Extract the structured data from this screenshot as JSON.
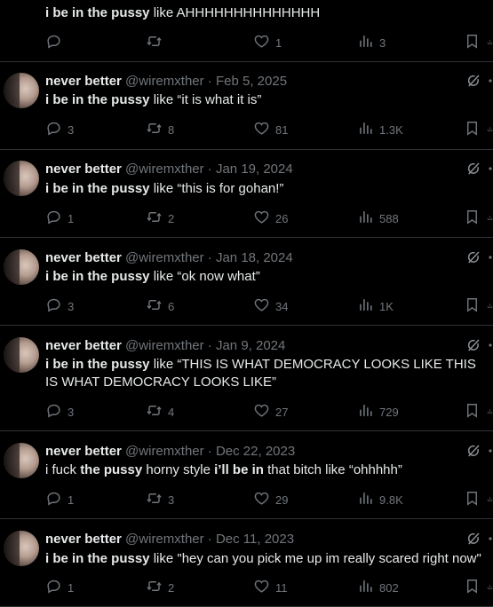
{
  "icons": {
    "reply": "speech-bubble-icon",
    "retweet": "retweet-arrows-icon",
    "like": "heart-icon",
    "views": "bar-chart-icon",
    "bookmark": "bookmark-icon",
    "grok": "grok-slash-circle-icon",
    "share": "share-icon"
  },
  "colors": {
    "background": "#000000",
    "text": "#e7e9ea",
    "muted": "#71767b",
    "divider": "#2f3336"
  },
  "tweets": [
    {
      "name": "",
      "handle": "",
      "date": "",
      "text_parts": [
        {
          "b": "i be in the pussy"
        },
        {
          "t": " like AHHHHHHHHHHHHHH"
        }
      ],
      "replies": "",
      "retweets": "",
      "likes": "1",
      "views": "3"
    },
    {
      "name": "never better",
      "handle": "@wiremxther",
      "date": "Feb 5, 2025",
      "text_parts": [
        {
          "b": "i be in the pussy"
        },
        {
          "t": " like “it is what it is”"
        }
      ],
      "replies": "3",
      "retweets": "8",
      "likes": "81",
      "views": "1.3K"
    },
    {
      "name": "never better",
      "handle": "@wiremxther",
      "date": "Jan 19, 2024",
      "text_parts": [
        {
          "b": "i be in the pussy"
        },
        {
          "t": " like “this is for gohan!”"
        }
      ],
      "replies": "1",
      "retweets": "2",
      "likes": "26",
      "views": "588"
    },
    {
      "name": "never better",
      "handle": "@wiremxther",
      "date": "Jan 18, 2024",
      "text_parts": [
        {
          "b": "i be in the pussy"
        },
        {
          "t": " like “ok now what”"
        }
      ],
      "replies": "3",
      "retweets": "6",
      "likes": "34",
      "views": "1K"
    },
    {
      "name": "never better",
      "handle": "@wiremxther",
      "date": "Jan 9, 2024",
      "text_parts": [
        {
          "b": "i be in the pussy"
        },
        {
          "t": " like “THIS IS WHAT DEMOCRACY LOOKS LIKE THIS IS WHAT DEMOCRACY LOOKS LIKE”"
        }
      ],
      "replies": "3",
      "retweets": "4",
      "likes": "27",
      "views": "729"
    },
    {
      "name": "never better",
      "handle": "@wiremxther",
      "date": "Dec 22, 2023",
      "text_parts": [
        {
          "t": "i fuck "
        },
        {
          "b": "the pussy"
        },
        {
          "t": " horny style "
        },
        {
          "b": "i’ll be in"
        },
        {
          "t": " that bitch like “ohhhhh”"
        }
      ],
      "replies": "1",
      "retweets": "3",
      "likes": "29",
      "views": "9.8K"
    },
    {
      "name": "never better",
      "handle": "@wiremxther",
      "date": "Dec 11, 2023",
      "text_parts": [
        {
          "b": "i be in the pussy"
        },
        {
          "t": " like \"hey can you pick me up im really scared right now\""
        }
      ],
      "replies": "1",
      "retweets": "2",
      "likes": "11",
      "views": "802"
    }
  ]
}
